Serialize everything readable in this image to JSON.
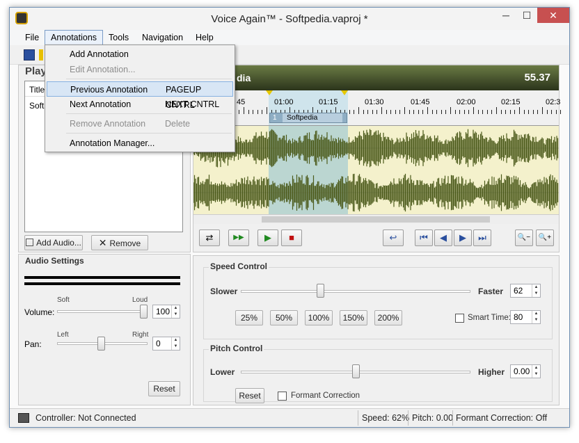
{
  "window": {
    "title": "Voice Again™ - Softpedia.vaproj *",
    "minimize": "─",
    "maximize": "☐",
    "close": "✕"
  },
  "menubar": {
    "items": [
      "File",
      "Annotations",
      "Tools",
      "Navigation",
      "Help"
    ]
  },
  "annotations_menu": {
    "add": "Add Annotation",
    "edit": "Edit Annotation...",
    "previous": "Previous Annotation",
    "previous_shortcut": "PAGEUP CNTRL",
    "next": "Next Annotation",
    "next_shortcut": "NEXT CNTRL",
    "remove": "Remove Annotation",
    "remove_shortcut": "Delete",
    "manager": "Annotation Manager..."
  },
  "playlist": {
    "header": "Play",
    "column_title": "Title",
    "row0": "Softp",
    "add_audio": "Add Audio...",
    "remove": "Remove"
  },
  "audio_settings": {
    "title": "Audio Settings",
    "volume_label": "Volume:",
    "soft": "Soft",
    "loud": "Loud",
    "volume_value": "100",
    "volume_level": 1.0,
    "pan_label": "Pan:",
    "left": "Left",
    "right": "Right",
    "pan_value": "0",
    "reset": "Reset"
  },
  "track": {
    "name_fragment": "dia",
    "time_display": "55.37",
    "timeline_labels": [
      "45",
      "01:00",
      "01:15",
      "01:30",
      "01:45",
      "02:00",
      "02:15",
      "02:3"
    ],
    "annotation_number": "1",
    "annotation_name": "Softpedia",
    "wave_color": "#4b5a1a",
    "wave_bg": "#f4f1cc",
    "selection_color": "#9cc8d4"
  },
  "transport": {
    "loop": "⇄",
    "play_from_start": "▶▶",
    "play": "▶",
    "stop": "■",
    "back": "↩",
    "first": "⏮",
    "prev": "◀",
    "next": "▶",
    "last": "⏭",
    "zoom_out": "🔍−",
    "zoom_in": "🔍+"
  },
  "speed_control": {
    "title": "Speed Control",
    "slower": "Slower",
    "faster": "Faster",
    "value": "62",
    "level": 0.62,
    "presets": [
      "25%",
      "50%",
      "100%",
      "150%",
      "200%"
    ],
    "smart_time_label": "Smart Time:",
    "smart_time_value": "80"
  },
  "pitch_control": {
    "title": "Pitch Control",
    "lower": "Lower",
    "higher": "Higher",
    "value": "0.00",
    "level": 0.5,
    "reset": "Reset",
    "formant": "Formant Correction"
  },
  "statusbar": {
    "controller": "Controller: Not Connected",
    "speed": "Speed: 62%",
    "pitch": "Pitch: 0.00",
    "formant": "Formant Correction: Off"
  }
}
